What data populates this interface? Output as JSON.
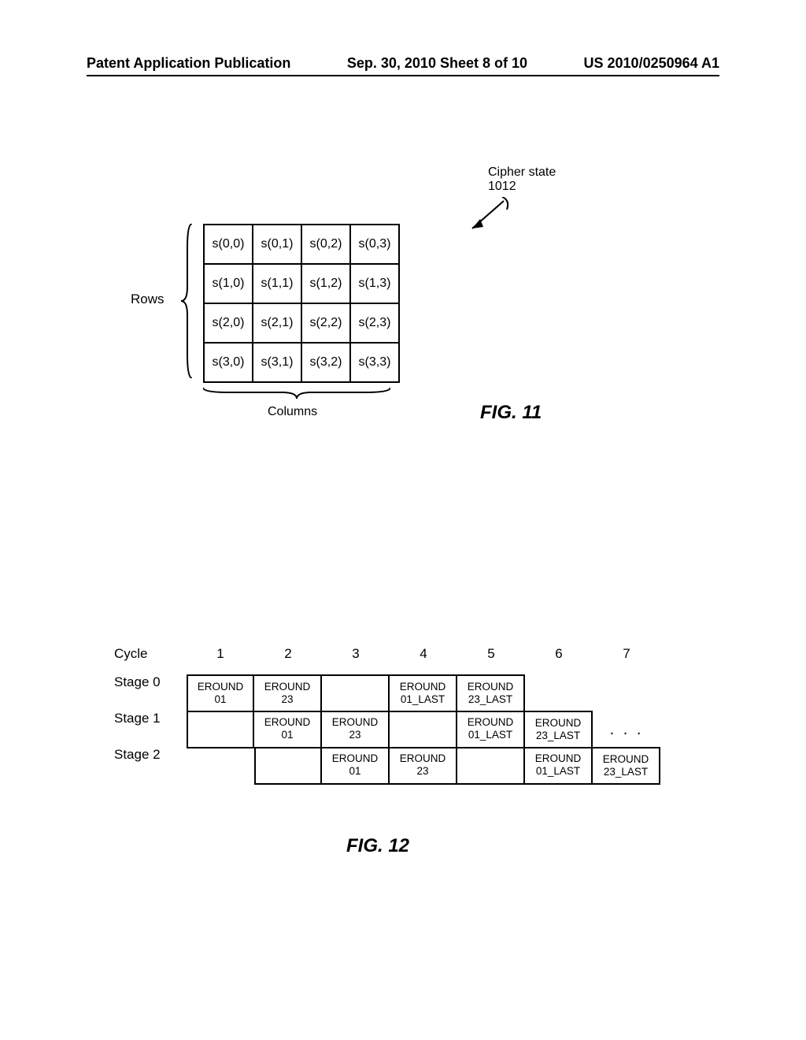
{
  "header": {
    "left": "Patent Application Publication",
    "center": "Sep. 30, 2010  Sheet 8 of 10",
    "right": "US 2010/0250964 A1"
  },
  "fig11": {
    "annotation": {
      "label_line1": "Cipher state",
      "label_line2": "1012"
    },
    "rows_label": "Rows",
    "columns_label": "Columns",
    "caption": "FIG. 11",
    "state": [
      [
        "s(0,0)",
        "s(0,1)",
        "s(0,2)",
        "s(0,3)"
      ],
      [
        "s(1,0)",
        "s(1,1)",
        "s(1,2)",
        "s(1,3)"
      ],
      [
        "s(2,0)",
        "s(2,1)",
        "s(2,2)",
        "s(2,3)"
      ],
      [
        "s(3,0)",
        "s(3,1)",
        "s(3,2)",
        "s(3,3)"
      ]
    ]
  },
  "fig12": {
    "cycle_label": "Cycle",
    "cycles": [
      "1",
      "2",
      "3",
      "4",
      "5",
      "6",
      "7"
    ],
    "stages": [
      {
        "label": "Stage 0",
        "cells": [
          {
            "l1": "EROUND",
            "l2": "01"
          },
          {
            "l1": "EROUND",
            "l2": "23"
          },
          {
            "empty": true
          },
          {
            "l1": "EROUND",
            "l2": "01_LAST"
          },
          {
            "l1": "EROUND",
            "l2": "23_LAST"
          },
          {
            "blank": true
          },
          {
            "blank": true
          }
        ]
      },
      {
        "label": "Stage 1",
        "cells": [
          {
            "empty": true
          },
          {
            "l1": "EROUND",
            "l2": "01"
          },
          {
            "l1": "EROUND",
            "l2": "23"
          },
          {
            "empty": true
          },
          {
            "l1": "EROUND",
            "l2": "01_LAST"
          },
          {
            "l1": "EROUND",
            "l2": "23_LAST"
          },
          {
            "ellipsis": true,
            "text": ". . ."
          }
        ]
      },
      {
        "label": "Stage 2",
        "cells": [
          {
            "blank": true
          },
          {
            "empty": true
          },
          {
            "l1": "EROUND",
            "l2": "01"
          },
          {
            "l1": "EROUND",
            "l2": "23"
          },
          {
            "empty": true
          },
          {
            "l1": "EROUND",
            "l2": "01_LAST"
          },
          {
            "l1": "EROUND",
            "l2": "23_LAST"
          }
        ]
      }
    ],
    "caption": "FIG. 12"
  }
}
